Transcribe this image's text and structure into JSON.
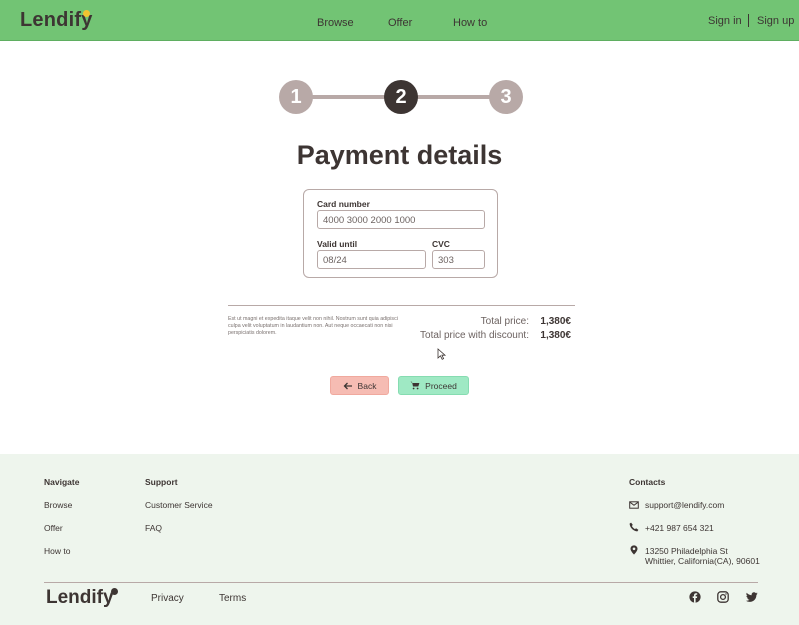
{
  "header": {
    "logo": "Lendify",
    "nav": {
      "browse": "Browse",
      "offer": "Offer",
      "how_to": "How to"
    },
    "sign_in": "Sign in",
    "sign_up": "Sign up"
  },
  "stepper": {
    "steps": [
      "1",
      "2",
      "3"
    ],
    "active_step": 2
  },
  "page_title": "Payment details",
  "form": {
    "card_number_label": "Card number",
    "card_number_value": "4000 3000 2000 1000",
    "valid_until_label": "Valid until",
    "valid_until_value": "08/24",
    "cvc_label": "CVC",
    "cvc_value": "303"
  },
  "fine_print": "Est ut magni et expedita itaque velit non nihil. Nostrum sunt quia adipisci culpa velit voluptatum in laudantium non. Aut neque occaecati non nisi perspiciatis dolorem.",
  "pricing": {
    "total_label": "Total price:",
    "total_value": "1,380€",
    "discount_label": "Total price with discount:",
    "discount_value": "1,380€"
  },
  "buttons": {
    "back": "Back",
    "proceed": "Proceed"
  },
  "footer": {
    "navigate": {
      "heading": "Navigate",
      "items": [
        "Browse",
        "Offer",
        "How to"
      ]
    },
    "support": {
      "heading": "Support",
      "items": [
        "Customer Service",
        "FAQ"
      ]
    },
    "contacts": {
      "heading": "Contacts",
      "email": "support@lendify.com",
      "phone": "+421 987 654 321",
      "address_line1": "13250 Philadelphia St",
      "address_line2": "Whittier, California(CA), 90601"
    },
    "logo": "Lendify",
    "privacy": "Privacy",
    "terms": "Terms",
    "social_icons": [
      "facebook-icon",
      "instagram-icon",
      "twitter-icon"
    ]
  },
  "colors": {
    "header_bg": "#72c474",
    "dark": "#3d3533",
    "step_inactive": "#b8a9a7",
    "back_button": "#f6bcb3",
    "proceed_button": "#9fe9c4",
    "footer_bg": "#eef5ed",
    "logo_accent": "#f2c230"
  }
}
